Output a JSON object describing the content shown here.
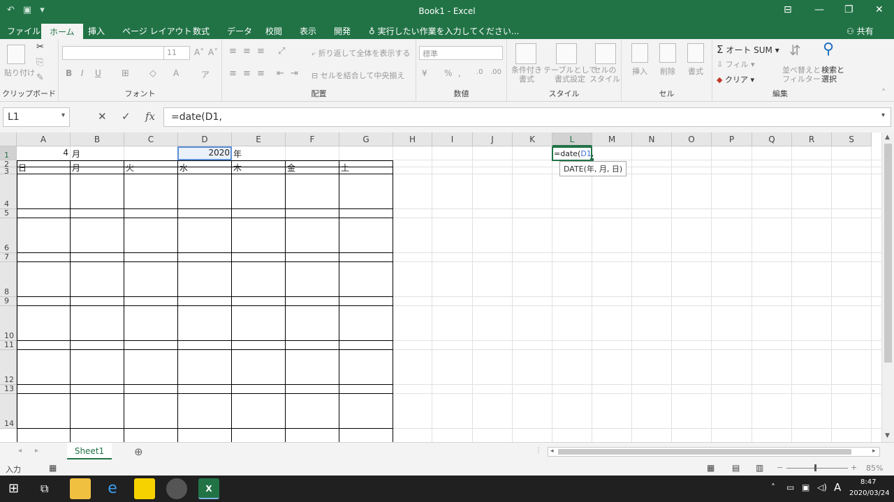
{
  "titlebar": {
    "title": "Book1 - Excel"
  },
  "tabs": [
    "ファイル",
    "ホーム",
    "挿入",
    "ページ レイアウト",
    "数式",
    "データ",
    "校閲",
    "表示",
    "開発"
  ],
  "tell_me": "実行したい作業を入力してください...",
  "share": "共有",
  "ribbon": {
    "clipboard": {
      "label": "クリップボード",
      "paste": "貼り付け"
    },
    "font": {
      "label": "フォント",
      "name": "",
      "size": "11"
    },
    "alignment": {
      "label": "配置",
      "wrap": "折り返して全体を表示する",
      "merge": "セルを結合して中央揃え"
    },
    "number": {
      "label": "数値",
      "format": "標準"
    },
    "styles": {
      "label": "スタイル",
      "conditional": [
        "条件付き",
        "書式"
      ],
      "table": [
        "テーブルとして",
        "書式設定"
      ],
      "cell": [
        "セルの",
        "スタイル"
      ]
    },
    "cells": {
      "label": "セル",
      "insert": "挿入",
      "delete": "削除",
      "format": "書式"
    },
    "editing": {
      "label": "編集",
      "autosum": "オート SUM",
      "fill": "フィル",
      "clear": "クリア",
      "sort": [
        "並べ替えと",
        "フィルター"
      ],
      "find": [
        "検索と",
        "選択"
      ]
    }
  },
  "formula_bar": {
    "name_box": "L1",
    "formula": "=date(D1,"
  },
  "columns": [
    "A",
    "B",
    "C",
    "D",
    "E",
    "F",
    "G",
    "H",
    "I",
    "J",
    "K",
    "L",
    "M",
    "N",
    "O",
    "P",
    "Q",
    "R",
    "S"
  ],
  "rows": [
    "1",
    "2",
    "3",
    "4",
    "5",
    "6",
    "7",
    "8",
    "9",
    "10",
    "11",
    "12",
    "13",
    "14"
  ],
  "cells": {
    "A1": "4",
    "B1": "月",
    "D1": "2020",
    "E1": "年",
    "A2": "日",
    "B2": "月",
    "C2": "火",
    "D2": "水",
    "E2": "木",
    "F2": "金",
    "G2": "土",
    "L1_prefix": "=date(",
    "L1_ref": "D1",
    "L1_suffix": ","
  },
  "tooltip": "DATE(年, 月, 日)",
  "sheet_tab": "Sheet1",
  "status": {
    "mode": "入力",
    "zoom": "85%"
  },
  "taskbar": {
    "ime": "A",
    "time": "8:47",
    "date": "2020/03/24"
  }
}
